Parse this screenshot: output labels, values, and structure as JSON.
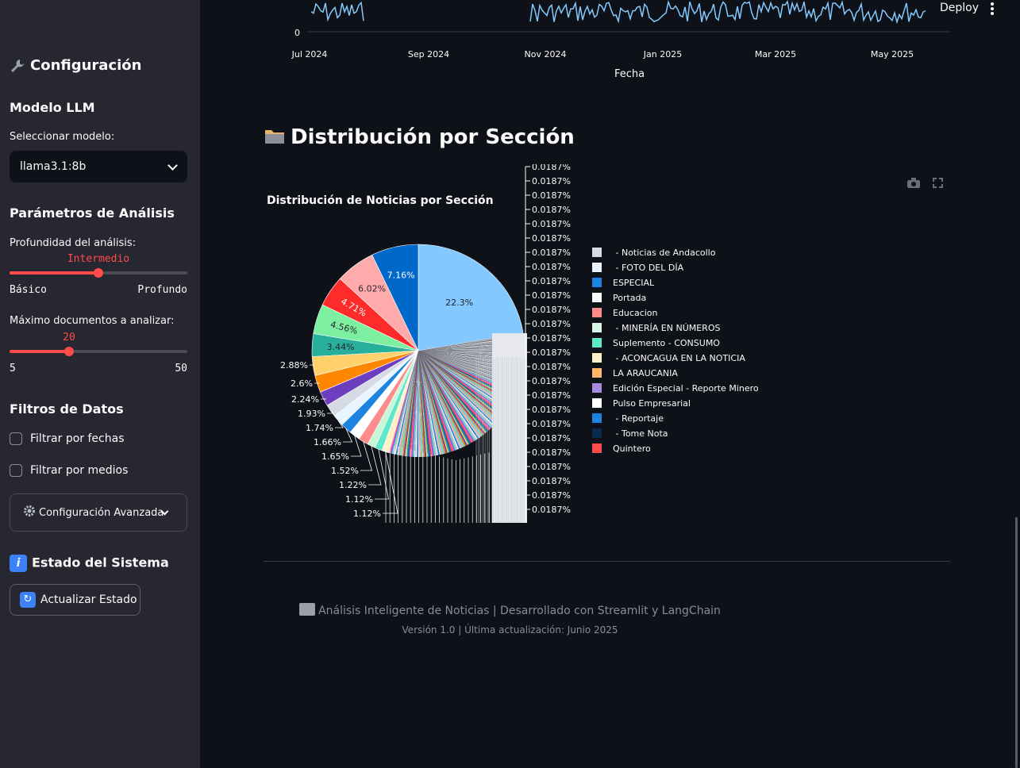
{
  "sidebar": {
    "title": "Configuración",
    "model_section": "Modelo LLM",
    "select_label": "Seleccionar modelo:",
    "selected_model": "llama3.1:8b",
    "params_section": "Parámetros de Análisis",
    "depth_label": "Profundidad del análisis:",
    "depth_value": "Intermedio",
    "depth_min": "Básico",
    "depth_max": "Profundo",
    "depth_level_fraction": 0.5,
    "max_docs_label": "Máximo documentos a analizar:",
    "max_docs_value": "20",
    "max_docs_min": "5",
    "max_docs_max": "50",
    "filters_section": "Filtros de Datos",
    "filter_dates": "Filtrar por fechas",
    "filter_media": "Filtrar por medios",
    "advanced_config": "Configuración Avanzada",
    "status_section": "Estado del Sistema",
    "refresh_button": "Actualizar Estado"
  },
  "header": {
    "deploy": "Deploy"
  },
  "timeline": {
    "y_zero": "0",
    "x_ticks": [
      "Jul 2024",
      "Sep 2024",
      "Nov 2024",
      "Jan 2025",
      "Mar 2025",
      "May 2025"
    ],
    "x_label": "Fecha",
    "line_color": "#83c9ff"
  },
  "section": {
    "title": "Distribución por Sección"
  },
  "chart_data": {
    "type": "pie",
    "title": "Distribución de Noticias por Sección",
    "slices_percent": [
      22.3,
      7.16,
      6.02,
      4.71,
      4.56,
      3.44,
      2.88,
      2.6,
      2.24,
      1.93,
      1.74,
      1.66,
      1.65,
      1.52,
      1.22,
      1.12,
      1.12
    ],
    "slice_colors": [
      "#83c9ff",
      "#0068c9",
      "#ffabab",
      "#ff2b2b",
      "#7defa1",
      "#29b09d",
      "#ffd16a",
      "#ff8700",
      "#6d3fc0",
      "#d5dae5",
      "#e8f4ff",
      "#1c83e1",
      "#ffffff",
      "#ff8c8c",
      "#c6f7d8",
      "#5ee8c9",
      "#fff0c7"
    ],
    "slice_labels_shown": [
      "22.3%",
      "7.16%",
      "6.02%",
      "4.71%",
      "4.56%",
      "3.44%",
      "2.88%",
      "2.6%",
      "2.24%",
      "1.93%",
      "1.74%",
      "1.66%",
      "1.65%",
      "1.52%",
      "1.22%",
      "1.12%",
      "1.12%"
    ],
    "small_slice_label": "0.0187%",
    "small_slice_label_count": 25,
    "legend_placement": "right",
    "legend": [
      {
        "name": " - Noticias de Andacollo",
        "color": "#d5dae5"
      },
      {
        "name": " - FOTO DEL DÍA",
        "color": "#e8f4ff"
      },
      {
        "name": "ESPECIAL",
        "color": "#1c83e1"
      },
      {
        "name": "Portada",
        "color": "#ffffff"
      },
      {
        "name": "Educacion",
        "color": "#ff8c8c"
      },
      {
        "name": " - MINERÍA EN NÚMEROS",
        "color": "#d8f7e4"
      },
      {
        "name": "Suplemento - CONSUMO",
        "color": "#5ee8c9"
      },
      {
        "name": " - ACONCAGUA EN LA NOTICIA",
        "color": "#fff0c7"
      },
      {
        "name": "LA ARAUCANIA",
        "color": "#ffb768"
      },
      {
        "name": "Edición Especial - Reporte Minero",
        "color": "#a98bde"
      },
      {
        "name": "Pulso Empresarial",
        "color": "#ffffff"
      },
      {
        "name": " - Reportaje",
        "color": "#1c83e1"
      },
      {
        "name": " - Tome Nota",
        "color": "#0a2a4f"
      },
      {
        "name": "Quintero",
        "color": "#ff4b4b"
      }
    ]
  },
  "footer": {
    "line1": "Análisis Inteligente de Noticias | Desarrollado con Streamlit y LangChain",
    "line2": "Versión 1.0 | Última actualización: Junio 2025"
  }
}
